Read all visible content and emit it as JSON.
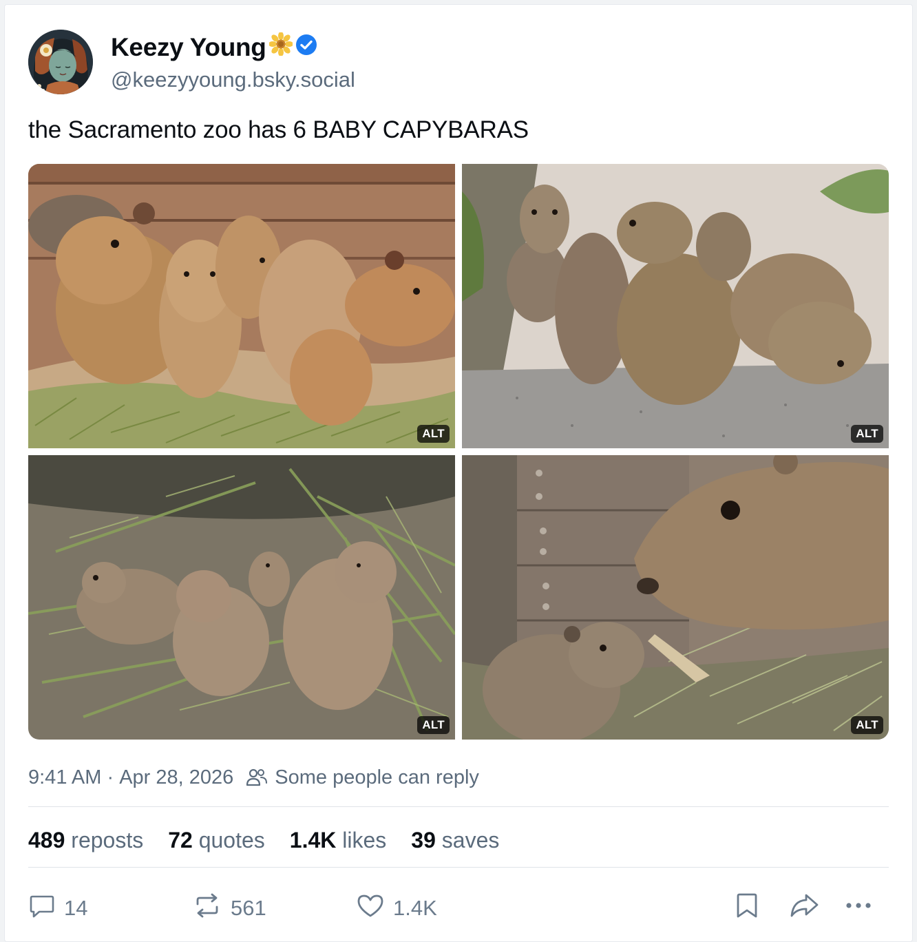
{
  "author": {
    "display_name": "Keezy Young",
    "handle": "@keezyyoung.bsky.social"
  },
  "post": {
    "text": "the Sacramento zoo has 6 BABY CAPYBARAS",
    "images": [
      {
        "alt_badge": "ALT"
      },
      {
        "alt_badge": "ALT"
      },
      {
        "alt_badge": "ALT"
      },
      {
        "alt_badge": "ALT"
      }
    ],
    "time": "9:41 AM",
    "date": "Apr 28, 2026",
    "reply_setting": "Some people can reply"
  },
  "stats": {
    "reposts": {
      "count": "489",
      "label": "reposts"
    },
    "quotes": {
      "count": "72",
      "label": "quotes"
    },
    "likes": {
      "count": "1.4K",
      "label": "likes"
    },
    "saves": {
      "count": "39",
      "label": "saves"
    }
  },
  "actions": {
    "reply_count": "14",
    "repost_count": "561",
    "like_count": "1.4K"
  },
  "colors": {
    "verified": "#1d7cf2",
    "muted_text": "#5b6b7c",
    "divider": "#dfe3e8"
  }
}
